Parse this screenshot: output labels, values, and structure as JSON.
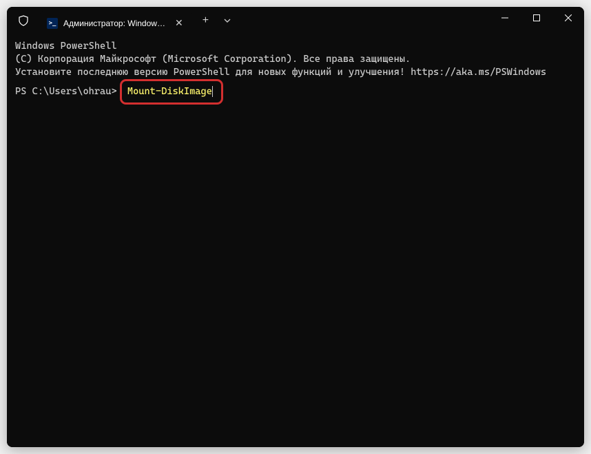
{
  "tab": {
    "title": "Администратор: Windows Po"
  },
  "terminal": {
    "line1": "Windows PowerShell",
    "line2": "(C) Корпорация Майкрософт (Microsoft Corporation). Все права защищены.",
    "line3": "",
    "line4": "Установите последнюю версию PowerShell для новых функций и улучшения! https://aka.ms/PSWindows",
    "line5": "",
    "prompt": "PS C:\\Users\\ohrau> ",
    "command": "Mount-DiskImage"
  }
}
